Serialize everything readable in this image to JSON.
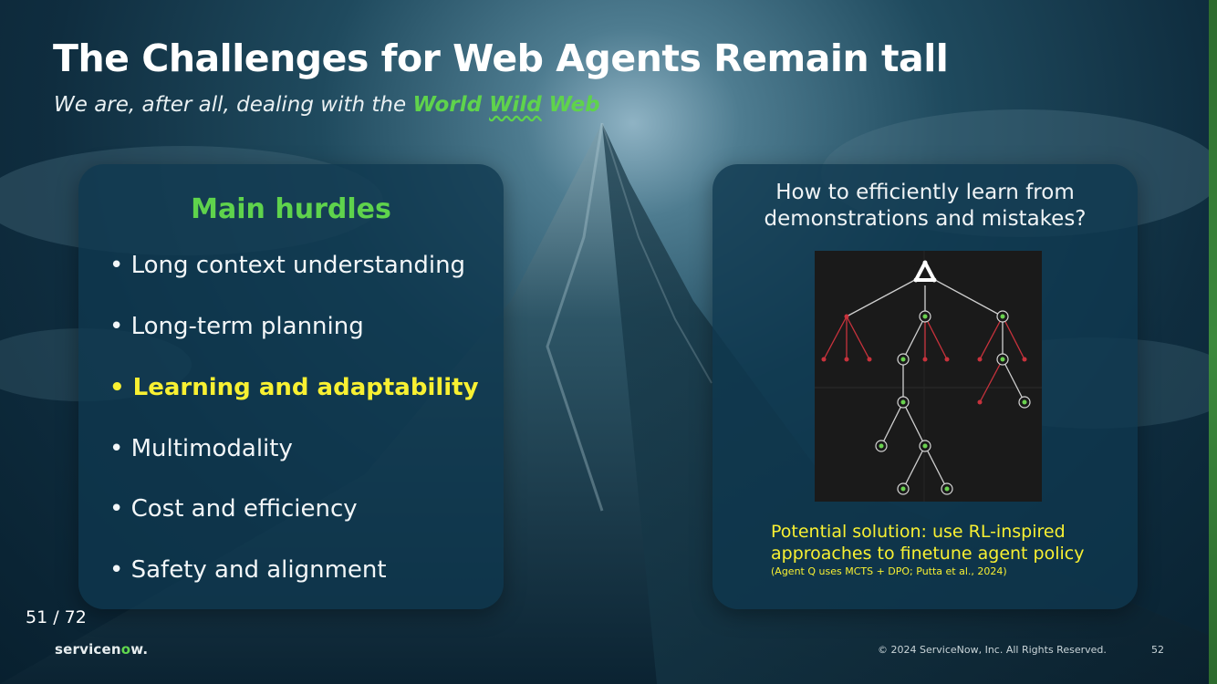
{
  "slide": {
    "title": "The Challenges for Web Agents Remain tall",
    "subtitle_prefix": "We are, after all, dealing with the ",
    "subtitle_hl1": "World ",
    "subtitle_hl2": "Wild",
    "subtitle_hl3": " Web"
  },
  "left_card": {
    "title": "Main hurdles",
    "items": [
      "• Long context understanding",
      "• Long-term planning",
      "• Learning and adaptability",
      "• Multimodality",
      "• Cost and efficiency",
      "• Safety and alignment"
    ],
    "highlighted_index": 2
  },
  "right_card": {
    "question_line1": "How to efficiently learn from",
    "question_line2": "demonstrations and mistakes?",
    "solution_line1": "Potential solution: use RL-inspired",
    "solution_line2": "approaches to finetune agent policy",
    "citation": "(Agent Q uses MCTS + DPO; Putta et al., 2024)"
  },
  "footer": {
    "page_counter": "51 / 72",
    "brand_prefix": "servicen",
    "brand_o": "o",
    "brand_suffix": "w.",
    "copyright": "© 2024 ServiceNow, Inc. All Rights Reserved.",
    "slide_number": "52"
  },
  "colors": {
    "accent_green": "#5fd34c",
    "highlight_yellow": "#f8f032",
    "tree_success": "#6ad24f",
    "tree_failure": "#c8323c"
  },
  "icons": [
    "servicenow-logo-icon"
  ]
}
